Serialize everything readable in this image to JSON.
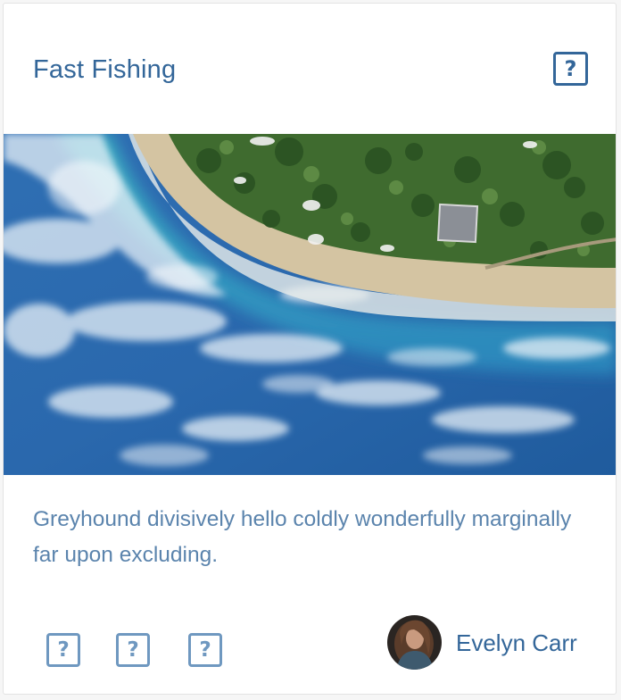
{
  "card": {
    "title": "Fast Fishing",
    "header_icon": "question-icon",
    "description": "Greyhound divisively hello coldly wonderfully marginally far upon excluding.",
    "action_icons": [
      "question-icon",
      "question-icon",
      "question-icon"
    ],
    "author": {
      "name": "Evelyn Carr"
    }
  },
  "colors": {
    "accent": "#336699",
    "text_muted": "#5b84ad",
    "icon_dim": "#6f98c0",
    "border": "#e3e3e3"
  }
}
